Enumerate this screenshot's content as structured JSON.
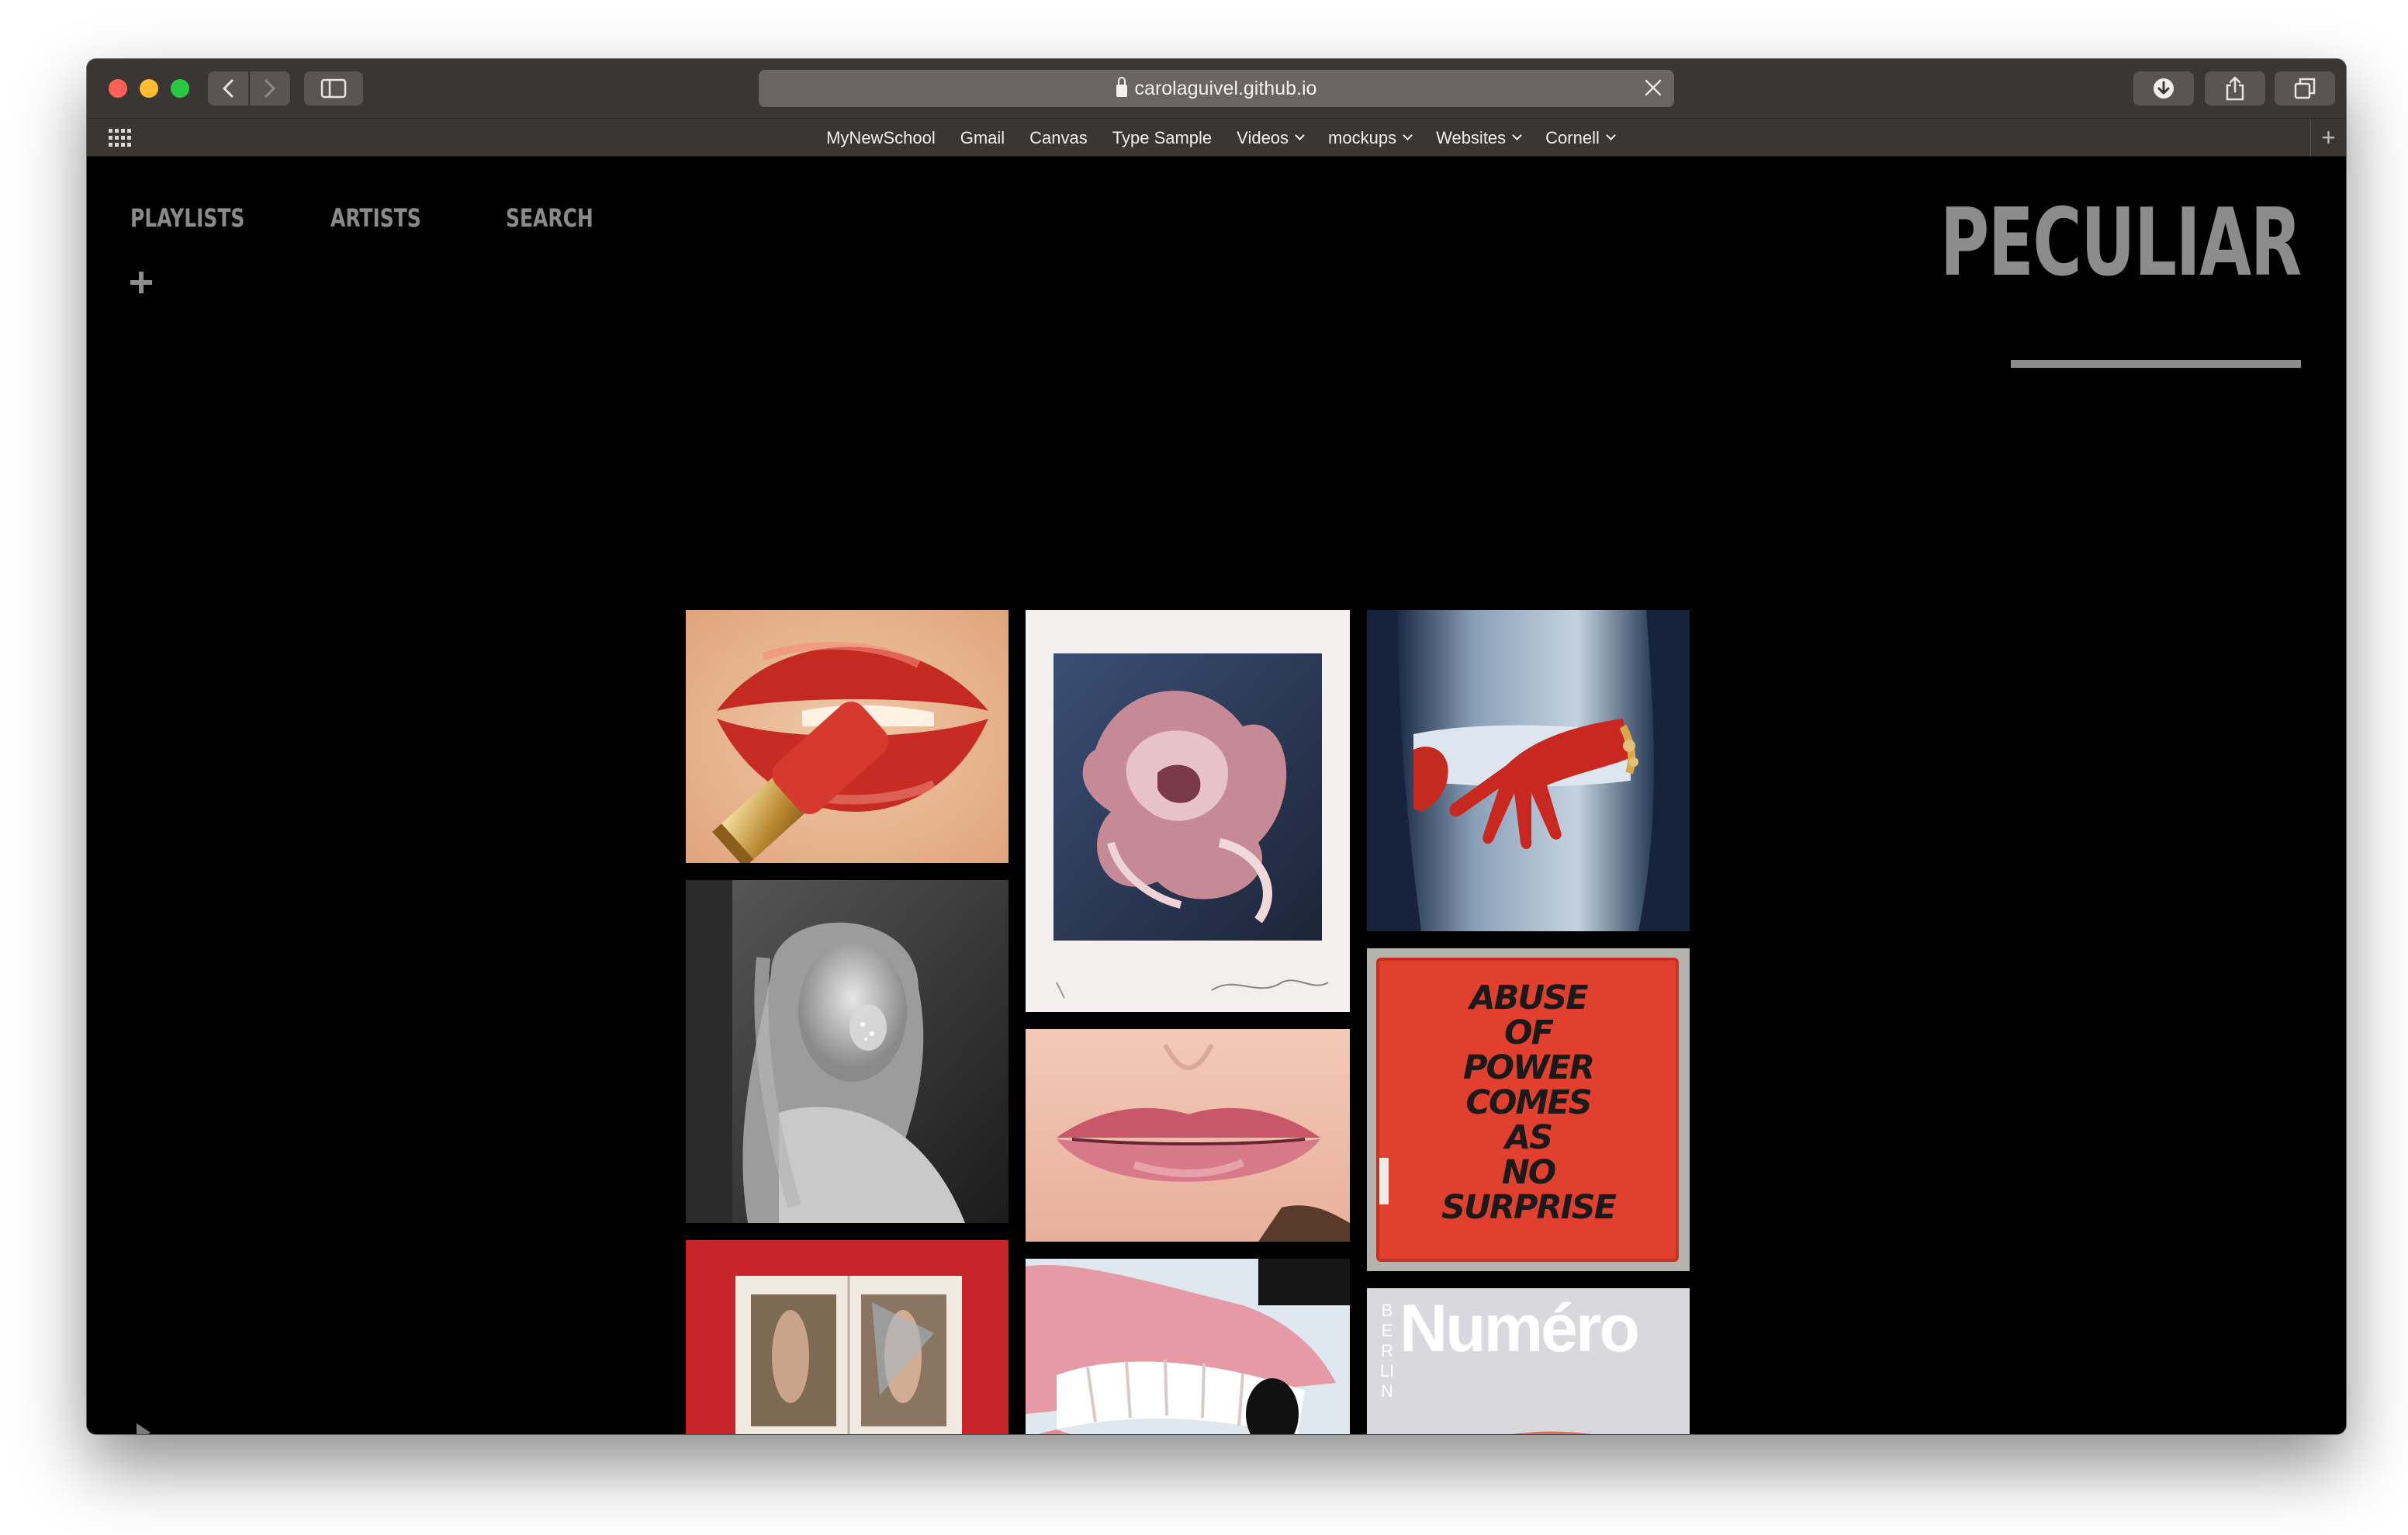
{
  "browser": {
    "url": "carolaguivel.github.io",
    "bookmarks": [
      {
        "label": "MyNewSchool",
        "has_menu": false
      },
      {
        "label": "Gmail",
        "has_menu": false
      },
      {
        "label": "Canvas",
        "has_menu": false
      },
      {
        "label": "Type Sample",
        "has_menu": false
      },
      {
        "label": "Videos",
        "has_menu": true
      },
      {
        "label": "mockups",
        "has_menu": true
      },
      {
        "label": "Websites",
        "has_menu": true
      },
      {
        "label": "Cornell",
        "has_menu": true
      }
    ]
  },
  "site": {
    "nav": {
      "playlists": "PLAYLISTS",
      "artists": "ARTISTS",
      "search": "SEARCH"
    },
    "logo": "PECULIAR",
    "gallery": {
      "poster_text": [
        "ABUSE",
        "OF",
        "POWER",
        "COMES",
        "AS",
        "NO",
        "SURPRISE"
      ],
      "magazine_title": "Numéro",
      "magazine_side": "BERLIN"
    }
  },
  "colors": {
    "accent_red": "#c8342c",
    "nav_gray": "#8a8a8a",
    "background": "#000000"
  }
}
